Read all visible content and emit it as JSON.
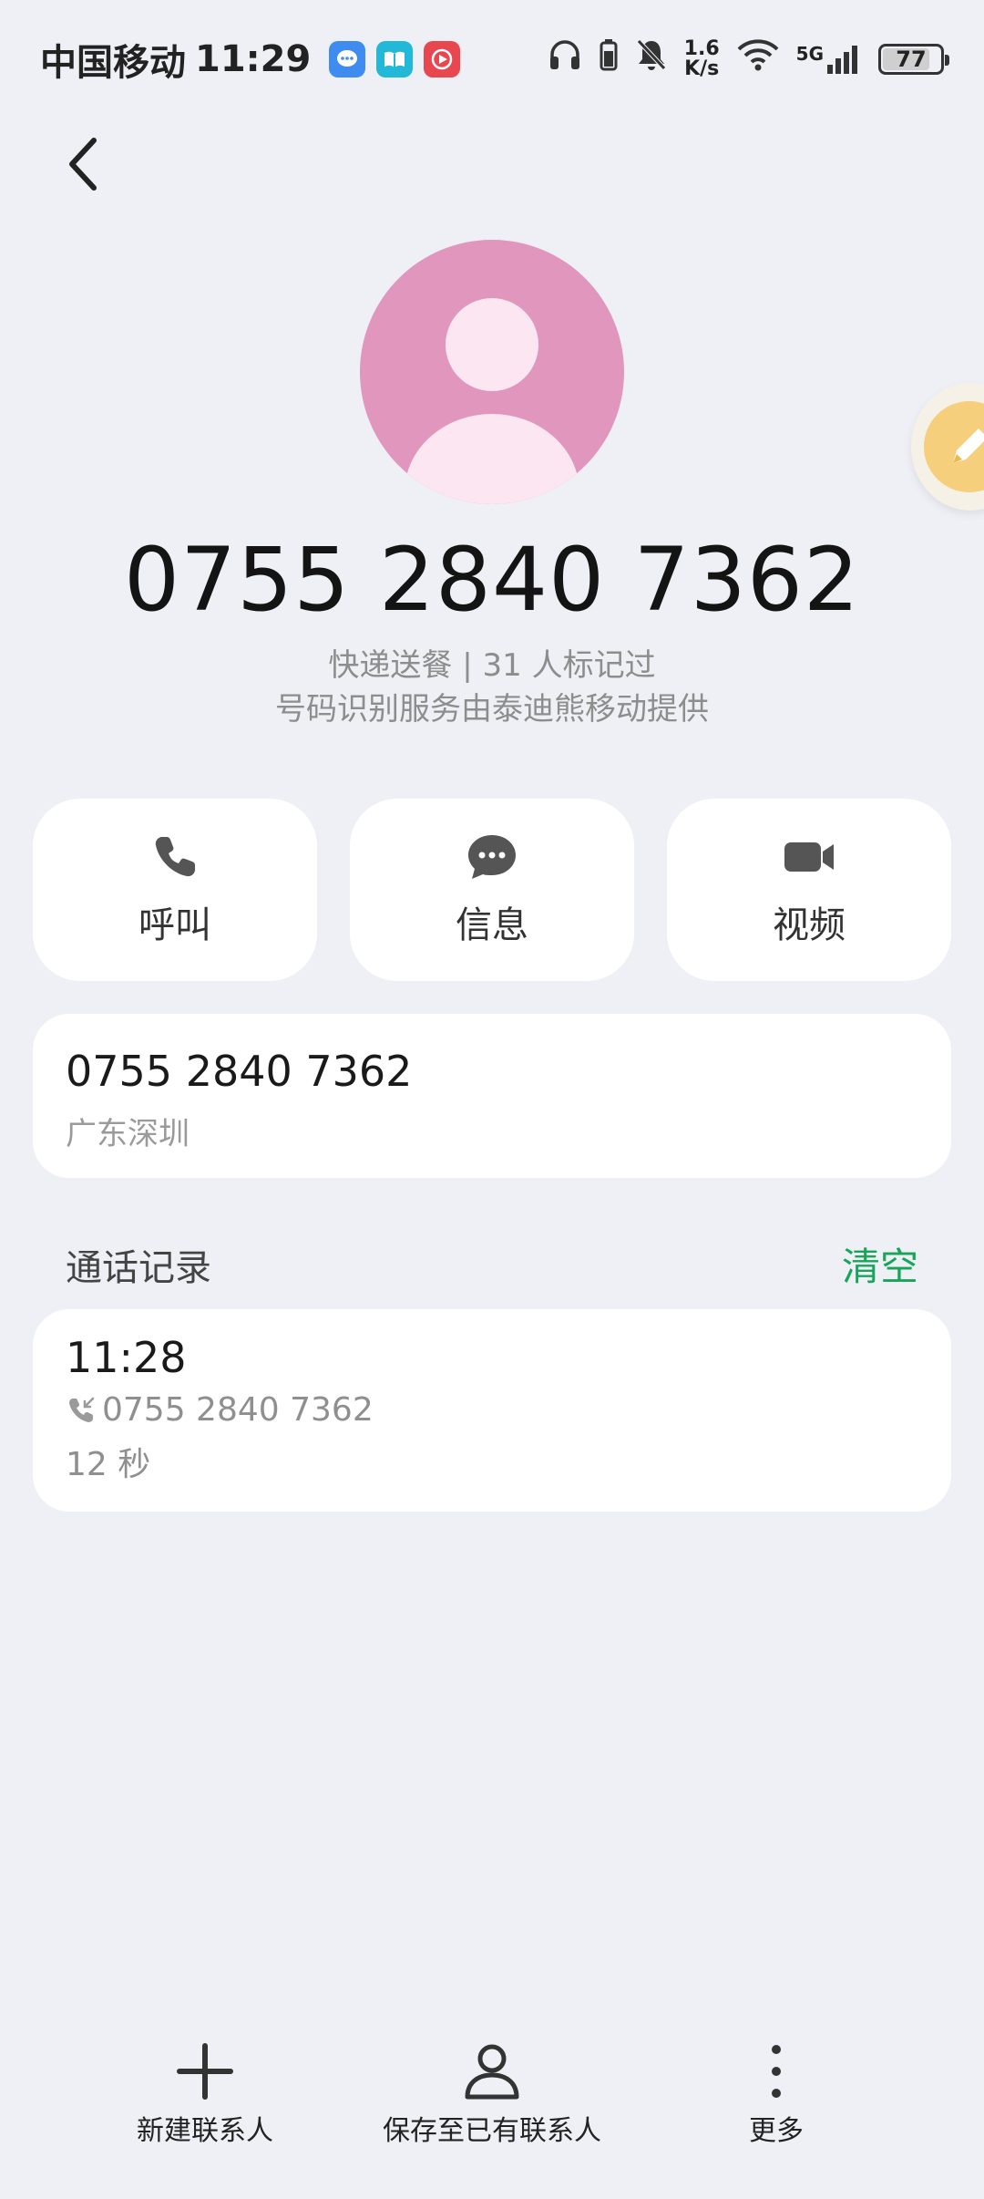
{
  "status_bar": {
    "carrier": "中国移动",
    "time": "11:29",
    "net_speed_value": "1.6",
    "net_speed_unit": "K/s",
    "network_type": "5G",
    "battery_level": "77",
    "icons": [
      "message-app-icon",
      "reader-app-icon",
      "video-app-icon",
      "headphones-icon",
      "battery-small-icon",
      "bell-off-icon",
      "wifi-icon",
      "signal-icon"
    ]
  },
  "contact": {
    "number": "0755 2840 7362",
    "tag": "快递送餐 | 31 人标记过",
    "service": "号码识别服务由泰迪熊移动提供"
  },
  "actions": [
    {
      "label": "呼叫",
      "icon": "phone-icon"
    },
    {
      "label": "信息",
      "icon": "message-icon"
    },
    {
      "label": "视频",
      "icon": "video-icon"
    }
  ],
  "number_card": {
    "number": "0755 2840 7362",
    "location": "广东深圳"
  },
  "call_log": {
    "title": "通话记录",
    "clear_label": "清空",
    "entries": [
      {
        "time": "11:28",
        "number": "0755 2840 7362",
        "duration": "12 秒",
        "icon": "incoming-call-icon"
      }
    ]
  },
  "bottom_bar": [
    {
      "label": "新建联系人",
      "icon": "plus-icon"
    },
    {
      "label": "保存至已有联系人",
      "icon": "person-icon"
    },
    {
      "label": "更多",
      "icon": "more-vertical-icon"
    }
  ],
  "colors": {
    "background": "#eff0f5",
    "avatar": "#e096bd",
    "accent_green": "#18a55a",
    "card": "#ffffff"
  }
}
